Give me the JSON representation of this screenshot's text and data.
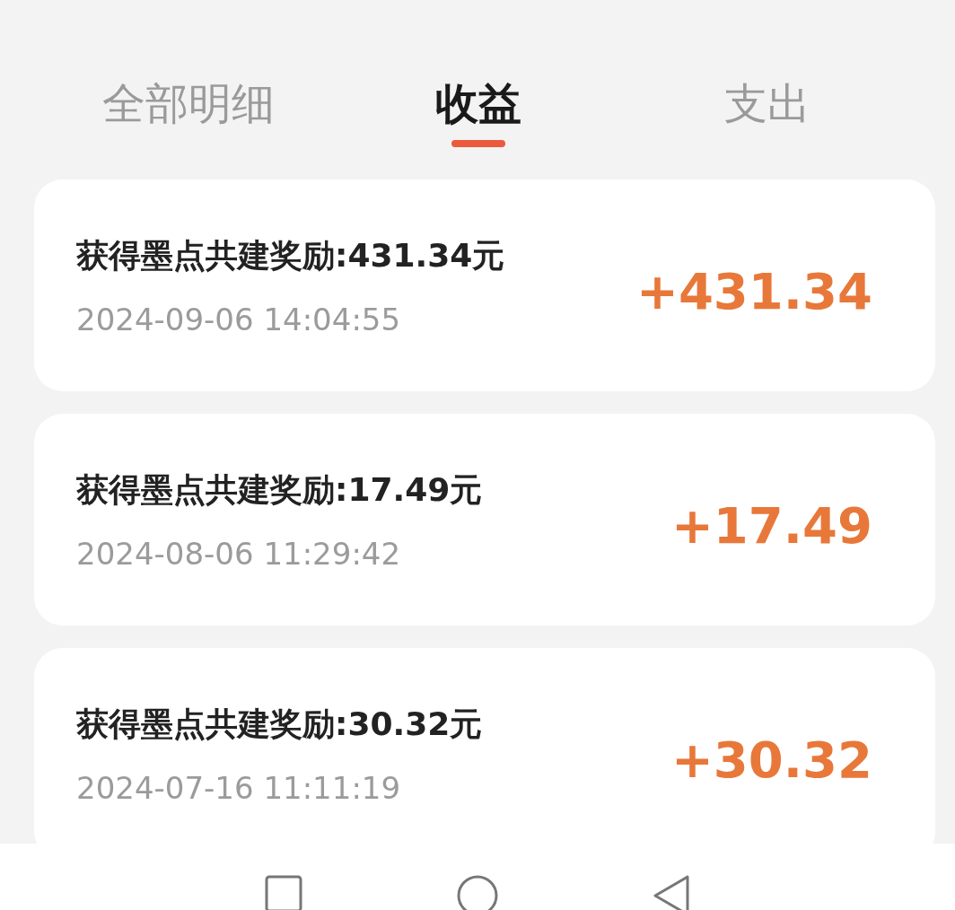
{
  "tabs": [
    {
      "label": "全部明细",
      "selected": false
    },
    {
      "label": "收益",
      "selected": true
    },
    {
      "label": "支出",
      "selected": false
    }
  ],
  "records": [
    {
      "title": "获得墨点共建奖励:431.34元",
      "time": "2024-09-06 14:04:55",
      "amount": "+431.34"
    },
    {
      "title": "获得墨点共建奖励:17.49元",
      "time": "2024-08-06 11:29:42",
      "amount": "+17.49"
    },
    {
      "title": "获得墨点共建奖励:30.32元",
      "time": "2024-07-16 11:11:19",
      "amount": "+30.32"
    }
  ]
}
